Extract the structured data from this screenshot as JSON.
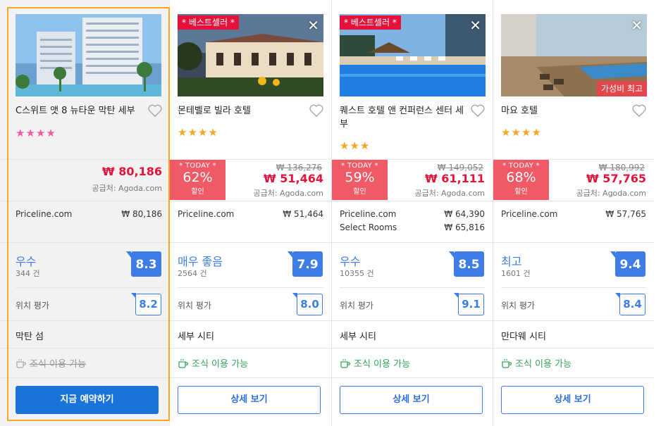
{
  "hotels": [
    {
      "name": "C스위트 앳 8 뉴타운 막탄 세부",
      "stars": "★★★★",
      "price": "₩ 80,186",
      "supplier": "공급처: Agoda.com",
      "providers": [
        {
          "name": "Priceline.com",
          "price": "₩  80,186"
        }
      ],
      "rating_word": "우수",
      "reviews": "344 건",
      "score": "8.3",
      "location_label": "위치 평가",
      "location_score": "8.2",
      "city": "막탄 섬",
      "breakfast": "조식 이용 가능",
      "button": "지금 예약하기"
    },
    {
      "name": "몬테벨로 빌라 호텔",
      "badge": "* 베스트셀러 *",
      "stars": "★★★★",
      "today_label": "* TODAY *",
      "discount": "62%",
      "discount_suffix": "할인",
      "original_price": "₩ 136,276",
      "price": "₩ 51,464",
      "supplier": "공급처: Agoda.com",
      "providers": [
        {
          "name": "Priceline.com",
          "price": "₩  51,464"
        }
      ],
      "rating_word": "매우 좋음",
      "reviews": "2564 건",
      "score": "7.9",
      "location_label": "위치 평가",
      "location_score": "8.0",
      "city": "세부 시티",
      "breakfast": "조식 이용 가능",
      "button": "상세 보기"
    },
    {
      "name": "퀘스트 호텔 앤 컨퍼런스 센터 세부",
      "badge": "* 베스트셀러 *",
      "stars": "★★★",
      "today_label": "* TODAY *",
      "discount": "59%",
      "discount_suffix": "할인",
      "original_price": "₩ 149,052",
      "price": "₩ 61,111",
      "supplier": "공급처: Agoda.com",
      "providers": [
        {
          "name": "Priceline.com",
          "price": "₩  64,390"
        },
        {
          "name": "Select Rooms",
          "price": "₩  65,816"
        }
      ],
      "rating_word": "우수",
      "reviews": "10355 건",
      "score": "8.5",
      "location_label": "위치 평가",
      "location_score": "9.1",
      "city": "세부 시티",
      "breakfast": "조식 이용 가능",
      "button": "상세 보기"
    },
    {
      "name": "마요 호텔",
      "value_badge": "가성비 최고",
      "stars": "★★★★",
      "today_label": "* TODAY *",
      "discount": "68%",
      "discount_suffix": "할인",
      "original_price": "₩ 180,992",
      "price": "₩ 57,765",
      "supplier": "공급처: Agoda.com",
      "providers": [
        {
          "name": "Priceline.com",
          "price": "₩  57,765"
        }
      ],
      "rating_word": "최고",
      "reviews": "1601 건",
      "score": "9.4",
      "location_label": "위치 평가",
      "location_score": "8.4",
      "city": "만다웨 시티",
      "breakfast": "조식 이용 가능",
      "button": "상세 보기"
    }
  ],
  "close_glyph": "✕"
}
